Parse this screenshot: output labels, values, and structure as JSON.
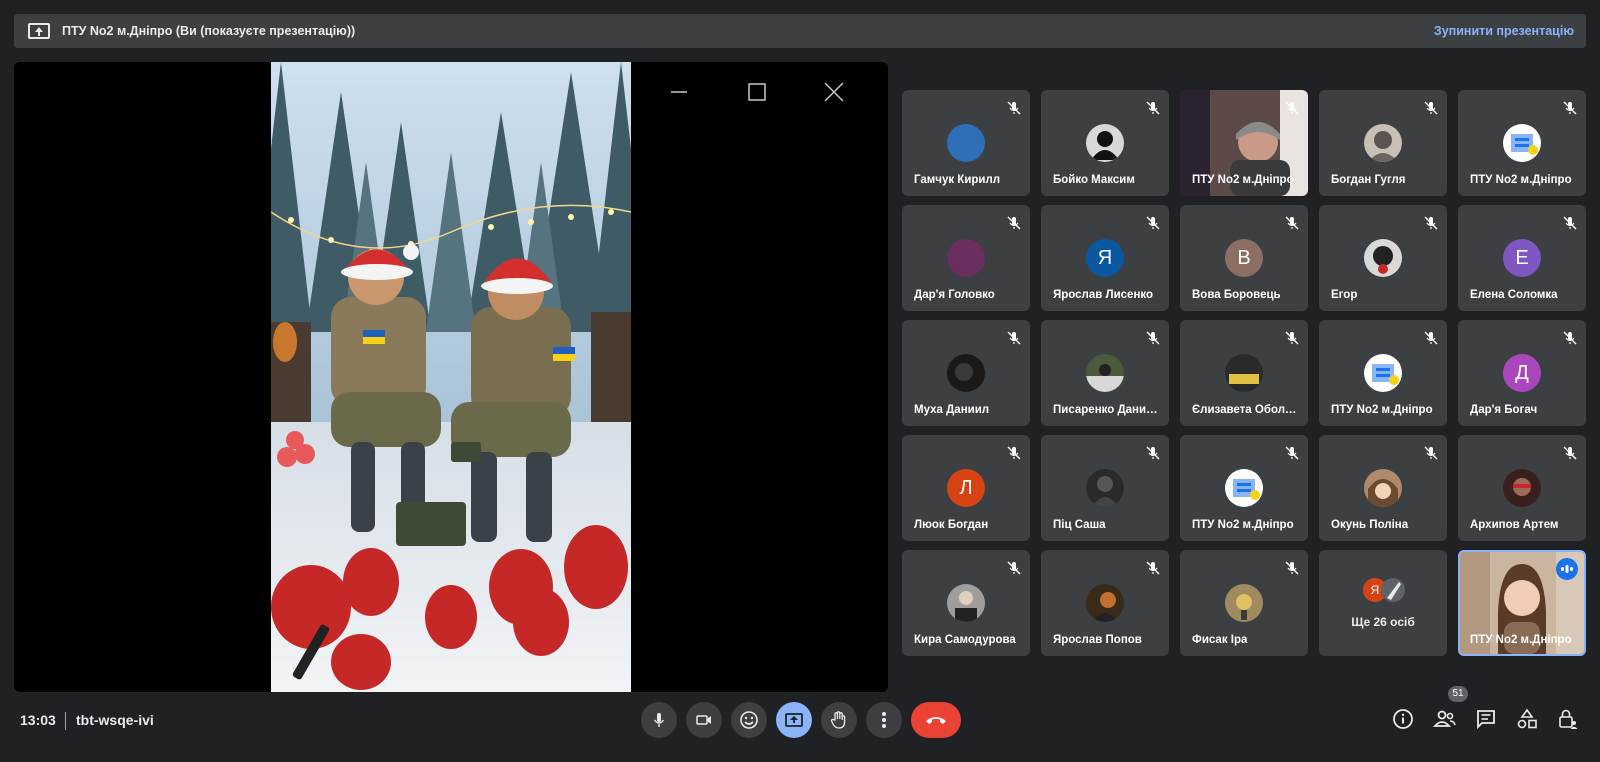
{
  "banner": {
    "title": "ПТУ No2 м.Дніпро (Ви (показуєте презентацію))",
    "stop_label": "Зупинити презентацію"
  },
  "participants": [
    {
      "name": "Гамчук Кирилл",
      "avatar_color": "#2f6fb8"
    },
    {
      "name": "Бойко Максим",
      "avatar_color": "#cfcfcf"
    },
    {
      "name": "ПТУ No2 м.Дніпро",
      "avatar_color": "#6b5a55"
    },
    {
      "name": "Богдан Гугля",
      "avatar_color": "#c8c0b5"
    },
    {
      "name": "ПТУ No2 м.Дніпро",
      "avatar_color": "#ffffff"
    },
    {
      "name": "Дар'я Головко",
      "avatar_color": "#6a2f5f"
    },
    {
      "name": "Ярослав Лисенко",
      "initial": "Я",
      "avatar_color": "#0b57a0"
    },
    {
      "name": "Вова Боровець",
      "initial": "В",
      "avatar_color": "#8d6e63"
    },
    {
      "name": "Егор",
      "avatar_color": "#d9d9d9"
    },
    {
      "name": "Елена Соломка",
      "initial": "Е",
      "avatar_color": "#7e57c2"
    },
    {
      "name": "Муха Даниил",
      "avatar_color": "#1a1a1a"
    },
    {
      "name": "Писаренко Данило",
      "avatar_color": "#4a5a3a"
    },
    {
      "name": "Єлизавета Оболенська",
      "avatar_color": "#2a2a2a"
    },
    {
      "name": "ПТУ No2 м.Дніпро",
      "avatar_color": "#ffffff"
    },
    {
      "name": "Дар'я Богач",
      "initial": "Д",
      "avatar_color": "#ab47bc"
    },
    {
      "name": "Люок Богдан",
      "initial": "Л",
      "avatar_color": "#d84315"
    },
    {
      "name": "Піц Саша",
      "avatar_color": "#2a2a2a"
    },
    {
      "name": "ПТУ No2 м.Дніпро",
      "avatar_color": "#ffffff"
    },
    {
      "name": "Окунь Поліна",
      "avatar_color": "#b08a6a"
    },
    {
      "name": "Архипов Артем",
      "avatar_color": "#3a1f1f"
    },
    {
      "name": "Кира Самодурова",
      "avatar_color": "#9e9e9e"
    },
    {
      "name": "Ярослав Попов",
      "avatar_color": "#3a2a1a"
    },
    {
      "name": "Фисак Іра",
      "avatar_color": "#a08a60"
    }
  ],
  "more_tile": {
    "label": "Ще 26 осіб",
    "initial": "Я"
  },
  "self_tile": {
    "name": "ПТУ No2 м.Дніпро"
  },
  "bottom": {
    "time": "13:03",
    "meeting_code": "tbt-wsqe-ivi",
    "people_count": "51"
  },
  "colors": {
    "accent": "#8ab4f8",
    "end_call": "#ea4335",
    "tile": "#3c4043",
    "background": "#202124"
  }
}
